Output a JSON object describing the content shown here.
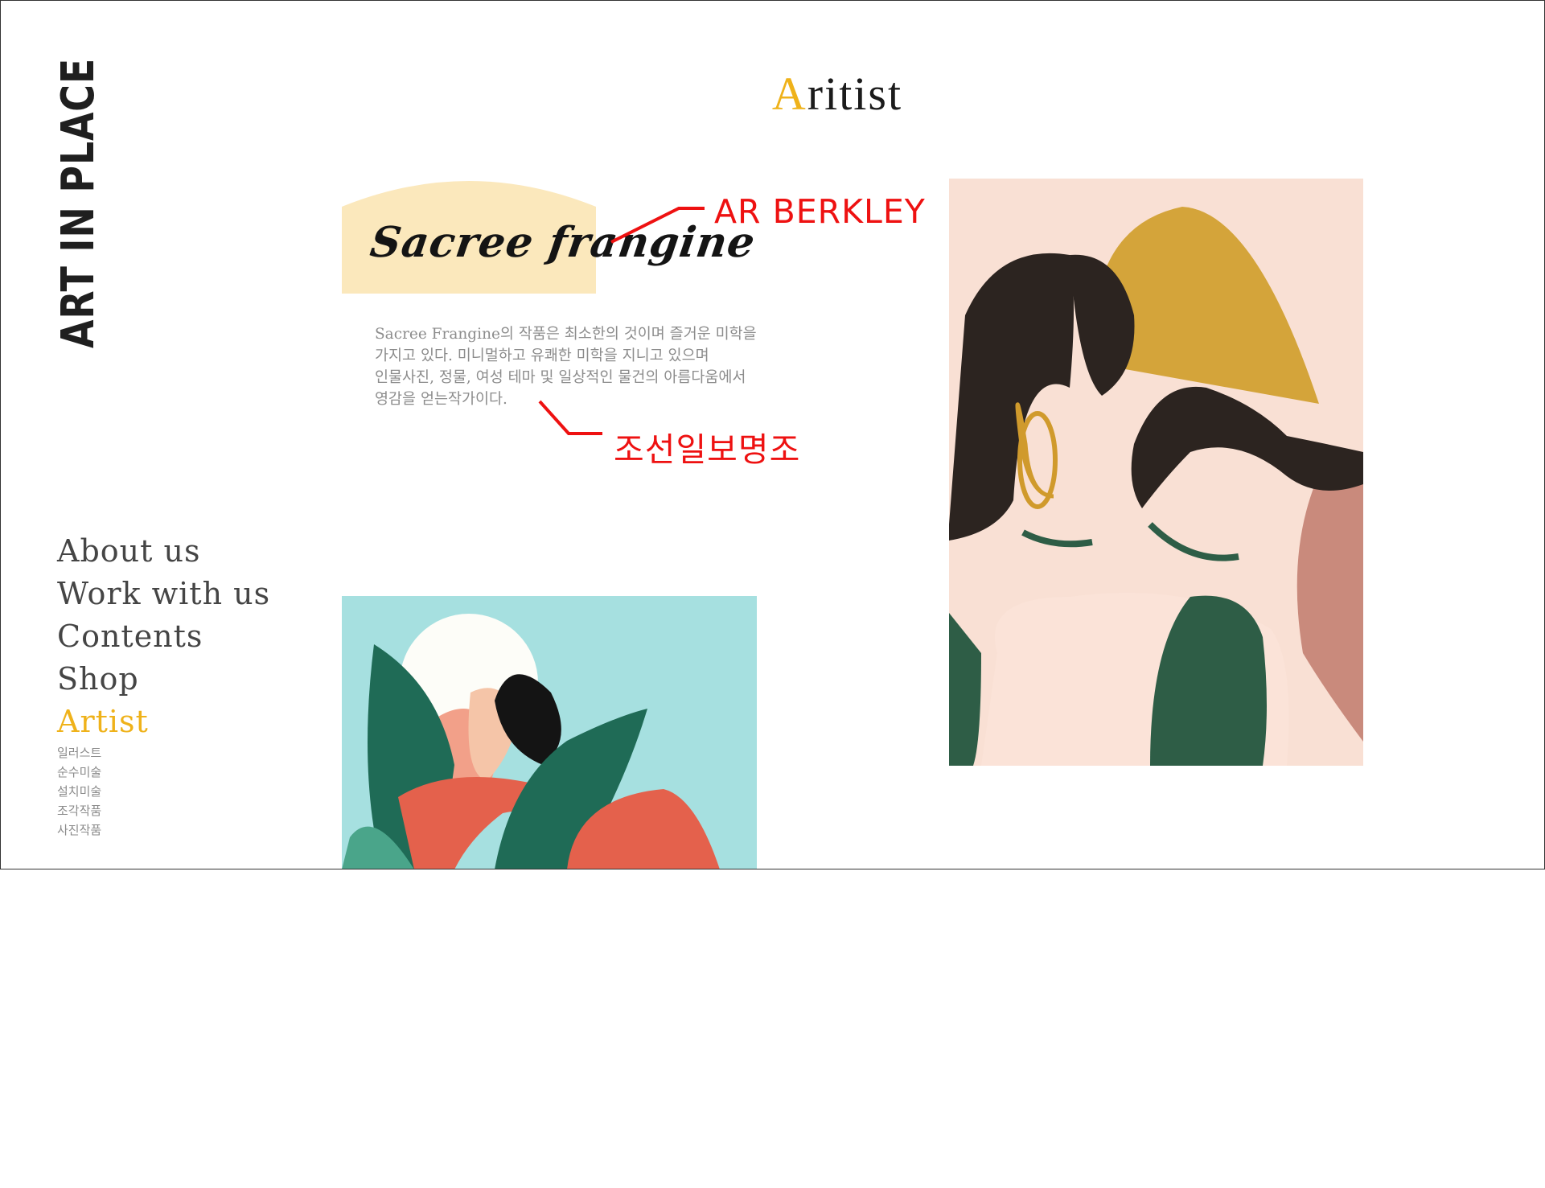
{
  "brand": {
    "logo_text": "ART IN PLACE"
  },
  "page_title": {
    "accent_letter": "A",
    "rest": "ritist"
  },
  "nav": {
    "items": [
      {
        "label": "About us"
      },
      {
        "label": "Work with us"
      },
      {
        "label": "Contents"
      },
      {
        "label": "Shop"
      },
      {
        "label": "Artist"
      }
    ],
    "active": "Artist",
    "sub_items": [
      "일러스트",
      "순수미술",
      "설치미술",
      "조각작품",
      "사진작품"
    ]
  },
  "artist": {
    "name": "Sacree frangine",
    "description": "Sacree Frangine의 작품은 최소한의 것이며 즐거운 미학을 가지고 있다. 미니멀하고 유쾌한 미학을 지니고 있으며 인물사진, 정물, 여성 테마 및 일상적인 물건의 아름다움에서 영감을 얻는작가이다."
  },
  "annotations": {
    "title_font": "AR BERKLEY",
    "body_font": "조선일보명조"
  },
  "colors": {
    "accent": "#efb21a",
    "annotation": "#ee1111",
    "title_bg": "#fbe8bc",
    "artwork_right_bg": "#f9e0d4",
    "artwork_bottom_bg": "#a6e0e0"
  }
}
